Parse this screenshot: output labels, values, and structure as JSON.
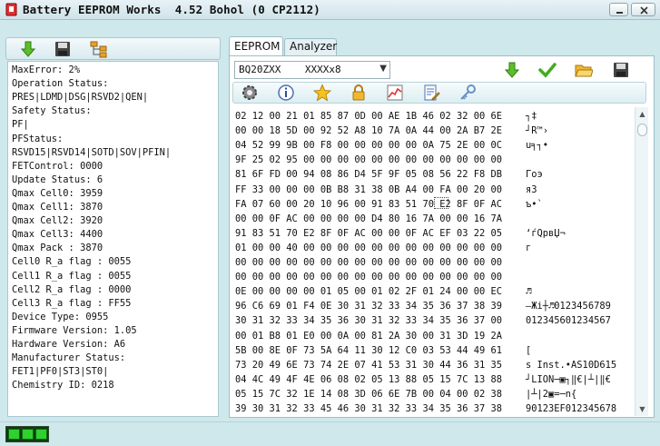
{
  "window": {
    "title": "Battery EEPROM Works  4.52 Bohol (0 CP2112)"
  },
  "left_toolbar": {
    "icons": [
      "download-arrow-icon",
      "save-disk-icon",
      "tree-structure-icon"
    ]
  },
  "info_lines": [
    "MaxError: 2%",
    "Operation Status:",
    "PRES|LDMD|DSG|RSVD2|QEN|",
    "Safety Status:",
    "PF|",
    "PFStatus:",
    "RSVD15|RSVD14|SOTD|SOV|PFIN|",
    "FETControl: 0000",
    "Update Status: 6",
    "Qmax Cell0: 3959",
    "Qmax Cell1: 3870",
    "Qmax Cell2: 3920",
    "Qmax Cell3: 4400",
    "Qmax Pack : 3870",
    "Cell0 R_a flag : 0055",
    "Cell1 R_a flag : 0055",
    "Cell2 R_a flag : 0000",
    "Cell3 R_a flag : FF55",
    "Device Type: 0955",
    "Firmware Version: 1.05",
    "Hardware Version: A6",
    "Manufacturer Status:",
    "FET1|PF0|ST3|ST0|",
    "Chemistry ID: 0218"
  ],
  "tabs": [
    {
      "label": "EEPROM",
      "active": true
    },
    {
      "label": "Analyzer",
      "active": false
    }
  ],
  "chip_select": {
    "value": "BQ20ZXX    XXXXx8"
  },
  "toolbar1_icons": [
    "download-arrow-icon",
    "check-icon",
    "open-folder-icon",
    "save-disk-icon"
  ],
  "toolbar2_icons": [
    "gear-icon",
    "info-icon",
    "star-icon",
    "lock-icon",
    "chart-icon",
    "edit-document-icon",
    "key-icon"
  ],
  "hex_rows": [
    {
      "hex": "02 12 00 21 01 85 87 0D 00 AE 1B 46 02 32 00 6E",
      "ascii": "┐‡"
    },
    {
      "hex": "00 00 18 5D 00 92 52 A8 10 7A 0A 44 00 2A B7 2E",
      "ascii": "┘R™›"
    },
    {
      "hex": "04 52 99 9B 00 F8 00 00 00 00 00 0A 75 2E 00 0C",
      "ascii": "u╕┐•"
    },
    {
      "hex": "9F 25 02 95 00 00 00 00 00 00 00 00 00 00 00 00",
      "ascii": ""
    },
    {
      "hex": "81 6F FD 00 94 08 86 D4 5F 9F 05 08 56 22 F8 DB",
      "ascii": "Гoэ"
    },
    {
      "hex": "FF 33 00 00 00 0B B8 31 38 0B A4 00 FA 00 20 00",
      "ascii": "я3"
    },
    {
      "hex": "FA 07 60 00 20 10 96 00 91 83 51 70 E2 8F 0F AC",
      "ascii": "ъ•`"
    },
    {
      "hex": "00 00 0F AC 00 00 00 00 D4 80 16 7A 00 00 16 7A",
      "ascii": ""
    },
    {
      "hex": "91 83 51 70 E2 8F 0F AC 00 00 0F AC EF 03 22 05",
      "ascii": "‘ѓQpвЏ¬"
    },
    {
      "hex": "01 00 00 40 00 00 00 00 00 00 00 00 00 00 00 00",
      "ascii": "г"
    },
    {
      "hex": "00 00 00 00 00 00 00 00 00 00 00 00 00 00 00 00",
      "ascii": ""
    },
    {
      "hex": "00 00 00 00 00 00 00 00 00 00 00 00 00 00 00 00",
      "ascii": ""
    },
    {
      "hex": "0E 00 00 00 00 01 05 00 01 02 2F 01 24 00 00 EC",
      "ascii": "♬"
    },
    {
      "hex": "96 C6 69 01 F4 0E 30 31 32 33 34 35 36 37 38 39",
      "ascii": "–Жi┼♬0123456789"
    },
    {
      "hex": "30 31 32 33 34 35 36 30 31 32 33 34 35 36 37 00",
      "ascii": "012345601234567"
    },
    {
      "hex": "00 01 B8 01 E0 00 0A 00 81 2A 30 00 31 3D 19 2A",
      "ascii": ""
    },
    {
      "hex": "5B 00 8E 0F 73 5A 64 11 30 12 C0 03 53 44 49 61",
      "ascii": "["
    },
    {
      "hex": "73 20 49 6E 73 74 2E 07 41 53 31 30 44 36 31 35",
      "ascii": "s Inst.•AS10D615"
    },
    {
      "hex": "04 4C 49 4F 4E 06 08 02 05 13 88 05 15 7C 13 88",
      "ascii": "┘LION─▣┐‖€|┴|‖€"
    },
    {
      "hex": "05 15 7C 32 1E 14 08 3D 06 6E 7B 00 04 00 02 38",
      "ascii": "|┴|2▣=─n{"
    },
    {
      "hex": "39 30 31 32 33 45 46 30 31 32 33 34 35 36 37 38",
      "ascii": "90123EF012345678"
    }
  ],
  "status_leds": 3
}
